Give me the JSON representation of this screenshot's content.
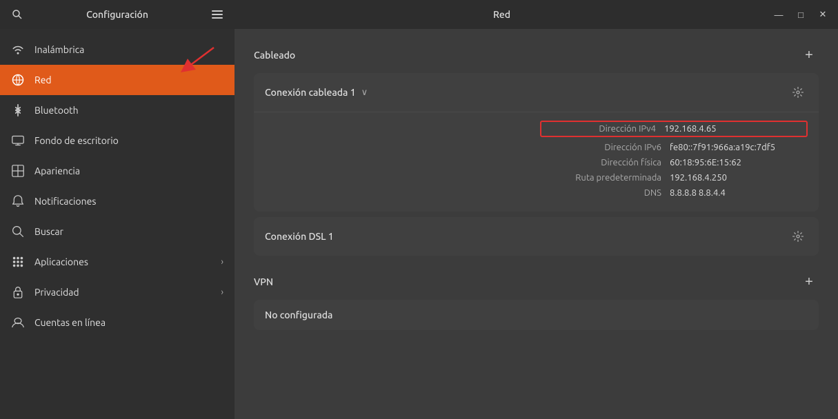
{
  "titlebar": {
    "left_title": "Configuración",
    "center_title": "Red",
    "minimize_label": "—",
    "maximize_label": "□",
    "close_label": "✕"
  },
  "sidebar": {
    "items": [
      {
        "id": "wireless",
        "label": "Inalámbrica",
        "icon": "📶",
        "active": false,
        "has_chevron": false
      },
      {
        "id": "network",
        "label": "Red",
        "icon": "🌐",
        "active": true,
        "has_chevron": false
      },
      {
        "id": "bluetooth",
        "label": "Bluetooth",
        "icon": "⬡",
        "active": false,
        "has_chevron": false
      },
      {
        "id": "desktop",
        "label": "Fondo de escritorio",
        "icon": "🖥",
        "active": false,
        "has_chevron": false
      },
      {
        "id": "appearance",
        "label": "Apariencia",
        "icon": "🎨",
        "active": false,
        "has_chevron": false
      },
      {
        "id": "notifications",
        "label": "Notificaciones",
        "icon": "🔔",
        "active": false,
        "has_chevron": false
      },
      {
        "id": "search",
        "label": "Buscar",
        "icon": "🔍",
        "active": false,
        "has_chevron": false
      },
      {
        "id": "apps",
        "label": "Aplicaciones",
        "icon": "⠿",
        "active": false,
        "has_chevron": true
      },
      {
        "id": "privacy",
        "label": "Privacidad",
        "icon": "🔒",
        "active": false,
        "has_chevron": true
      },
      {
        "id": "accounts",
        "label": "Cuentas en línea",
        "icon": "☁",
        "active": false,
        "has_chevron": false
      }
    ]
  },
  "right": {
    "wired_section": {
      "title": "Cableado",
      "add_btn": "+",
      "connections": [
        {
          "name": "Conexión cableada 1",
          "expanded": true,
          "ipv4_label": "Dirección IPv4",
          "ipv4_value": "192.168.4.65",
          "ipv6_label": "Dirección IPv6",
          "ipv6_value": "fe80::7f91:966a:a19c:7df5",
          "physical_label": "Dirección física",
          "physical_value": "60:18:95:6E:15:62",
          "default_route_label": "Ruta predeterminada",
          "default_route_value": "192.168.4.250",
          "dns_label": "DNS",
          "dns_value": "8.8.8.8 8.8.4.4"
        },
        {
          "name": "Conexión DSL 1",
          "expanded": false
        }
      ]
    },
    "vpn_section": {
      "title": "VPN",
      "add_btn": "+",
      "connections": [
        {
          "name": "No configurada",
          "expanded": false
        }
      ]
    }
  }
}
